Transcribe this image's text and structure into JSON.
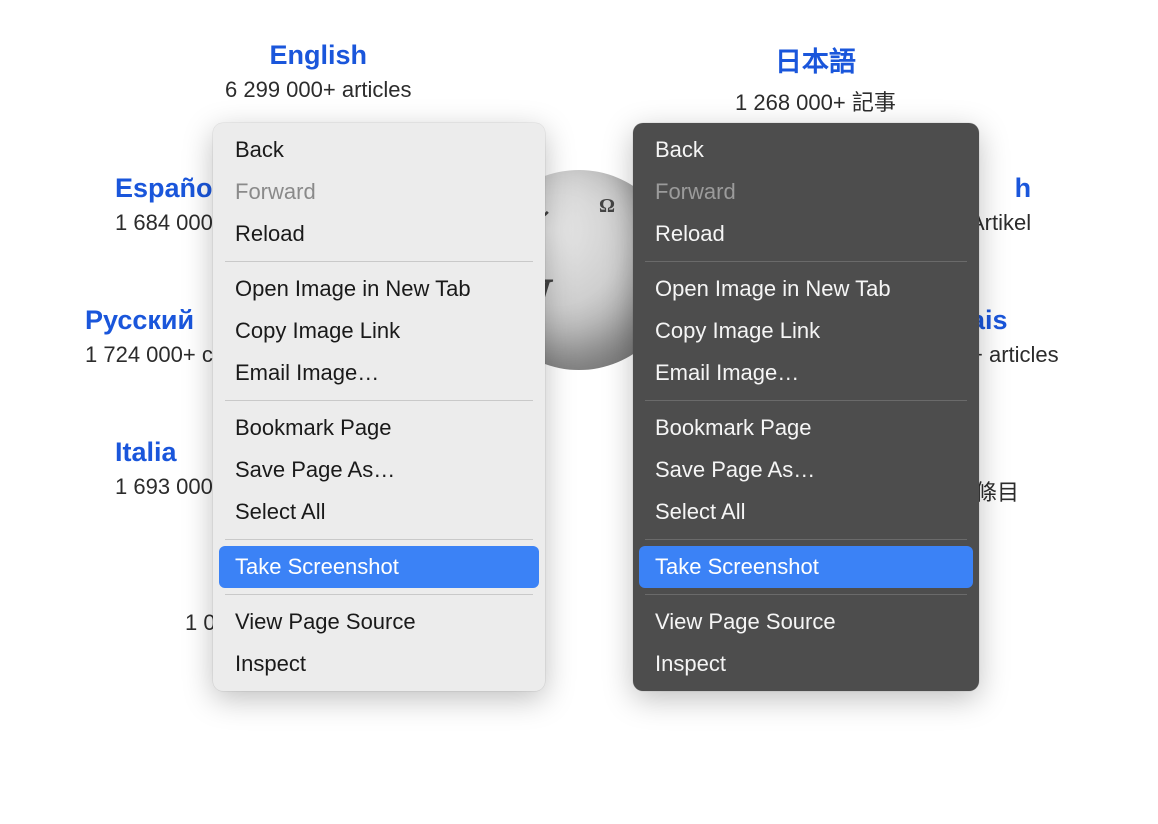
{
  "languages": {
    "english": {
      "title": "English",
      "sub": "6 299 000+ articles"
    },
    "japanese": {
      "title": "日本語",
      "sub": "1 268 000+ 記事"
    },
    "spanish": {
      "title": "Español",
      "sub": "1 684 000+"
    },
    "german": {
      "title_fragment": "h",
      "sub_fragment": "Artikel"
    },
    "russian": {
      "title": "Русский",
      "sub": "1 724 000+ с"
    },
    "french": {
      "title_fragment": "ais",
      "sub_fragment": "+ articles"
    },
    "italian": {
      "title": "Italia",
      "sub": "1 693 000"
    },
    "chinese": {
      "sub_fragment": "條目"
    }
  },
  "fragments": {
    "bottom_number": "1 0"
  },
  "context_menu_light": {
    "back": "Back",
    "forward": "Forward",
    "reload": "Reload",
    "open_image": "Open Image in New Tab",
    "copy_image": "Copy Image Link",
    "email_image": "Email Image…",
    "bookmark": "Bookmark Page",
    "save_as": "Save Page As…",
    "select_all": "Select All",
    "screenshot": "Take Screenshot",
    "view_source": "View Page Source",
    "inspect": "Inspect"
  },
  "context_menu_dark": {
    "back": "Back",
    "forward": "Forward",
    "reload": "Reload",
    "open_image": "Open Image in New Tab",
    "copy_image": "Copy Image Link",
    "email_image": "Email Image…",
    "bookmark": "Bookmark Page",
    "save_as": "Save Page As…",
    "select_all": "Select All",
    "screenshot": "Take Screenshot",
    "view_source": "View Page Source",
    "inspect": "Inspect"
  }
}
